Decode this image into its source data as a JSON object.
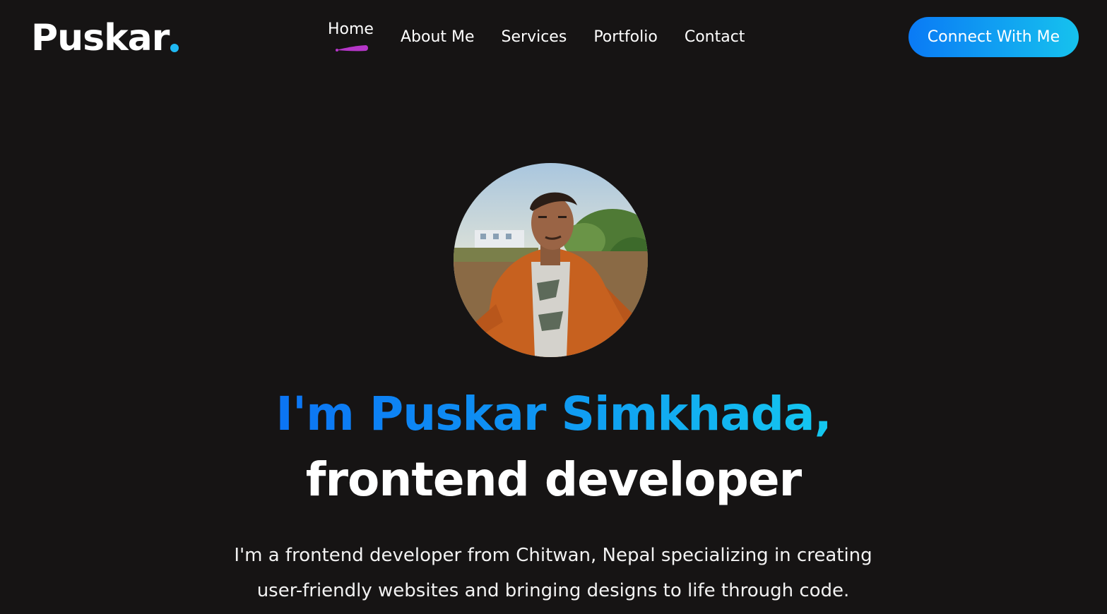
{
  "header": {
    "logo_text": "Puskar",
    "nav": [
      {
        "label": "Home",
        "active": true
      },
      {
        "label": "About Me"
      },
      {
        "label": "Services"
      },
      {
        "label": "Portfolio"
      },
      {
        "label": "Contact"
      }
    ],
    "cta_label": "Connect With Me"
  },
  "hero": {
    "headline_highlight": "I'm Puskar Simkhada,",
    "headline_rest": "frontend developer",
    "intro_line1": "I'm a frontend developer from Chitwan, Nepal specializing in creating",
    "intro_line2": "user-friendly websites and bringing designs to life through code."
  },
  "colors": {
    "background": "#161414",
    "accent_blue": "#0a7af5",
    "accent_cyan": "#16c2ee",
    "nav_underline": "#b536c8"
  }
}
